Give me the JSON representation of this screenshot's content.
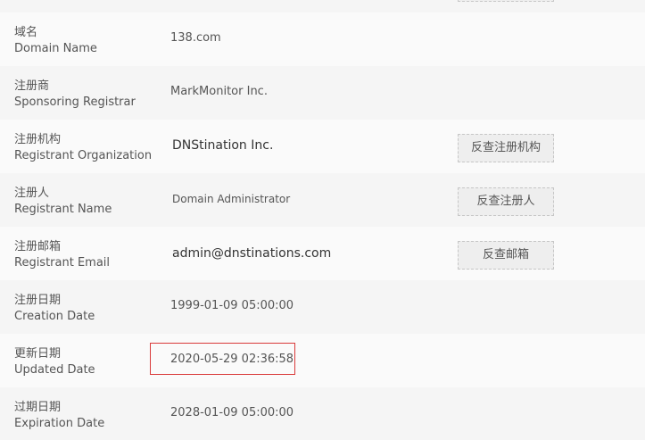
{
  "rows": [
    {
      "cn": "域名",
      "en": "Domain Name",
      "value": "138.com"
    },
    {
      "cn": "注册商",
      "en": "Sponsoring Registrar",
      "value": "MarkMonitor Inc."
    },
    {
      "cn": "注册机构",
      "en": "Registrant Organization",
      "value": "DNStination Inc.",
      "button": "反查注册机构"
    },
    {
      "cn": "注册人",
      "en": "Registrant Name",
      "value": "Domain Administrator",
      "button": "反查注册人"
    },
    {
      "cn": "注册邮箱",
      "en": "Registrant Email",
      "value": "admin@dnstinations.com",
      "button": "反查邮箱"
    },
    {
      "cn": "注册日期",
      "en": "Creation Date",
      "value": "1999-01-09 05:00:00"
    },
    {
      "cn": "更新日期",
      "en": "Updated Date",
      "value": "2020-05-29 02:36:58"
    },
    {
      "cn": "过期日期",
      "en": "Expiration Date",
      "value": "2028-01-09 05:00:00"
    }
  ],
  "colors": {
    "row_alt": "#f5f5f5",
    "row_plain": "#fafafa",
    "highlight": "#d93a3a"
  }
}
